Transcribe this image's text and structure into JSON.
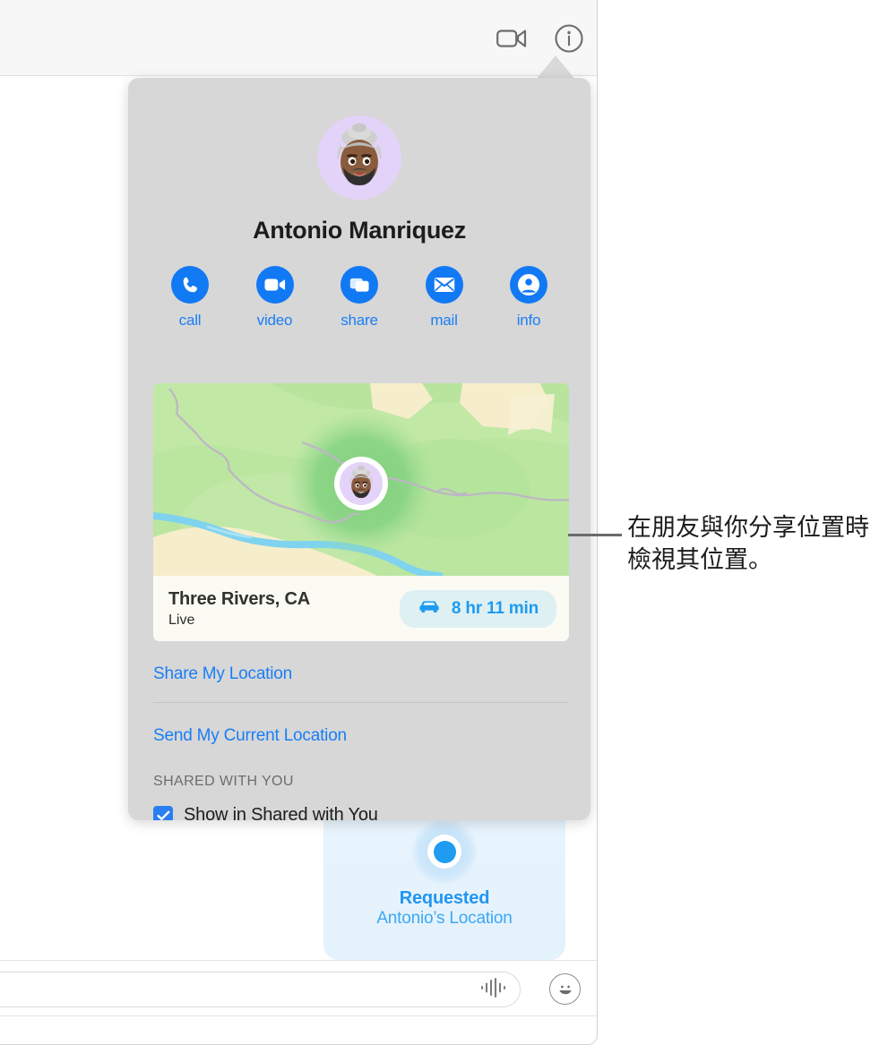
{
  "window": {
    "toolbar": {
      "video_icon": "video-camera-icon",
      "info_icon": "info-circle-icon"
    },
    "compose": {
      "audio_icon": "audio-waveform-icon",
      "emoji_icon": "smiley-face-icon",
      "placeholder": ""
    }
  },
  "bubble": {
    "title": "Requested",
    "subtitle": "Antonio’s Location",
    "dot_icon": "location-dot-icon",
    "accent": "#2196f3"
  },
  "popover": {
    "contact_name": "Antonio Manriquez",
    "avatar_icon": "memoji-avatar",
    "avatar_bg": "#e3d3f8",
    "actions": [
      {
        "label": "call",
        "icon": "phone-icon"
      },
      {
        "label": "video",
        "icon": "video-camera-icon"
      },
      {
        "label": "share",
        "icon": "screen-share-icon"
      },
      {
        "label": "mail",
        "icon": "envelope-icon"
      },
      {
        "label": "info",
        "icon": "person-circle-icon"
      }
    ],
    "action_accent": "#1279f4",
    "map": {
      "place": "Three Rivers, CA",
      "status": "Live",
      "eta": "8 hr 11 min",
      "eta_icon": "car-icon",
      "pin_icon": "memoji-map-pin"
    },
    "links": [
      {
        "label": "Share My Location"
      },
      {
        "label": "Send My Current Location"
      }
    ],
    "section_header": "SHARED WITH YOU",
    "checkbox_row": {
      "label": "Show in Shared with You",
      "checked": true,
      "check_icon": "checkmark-icon"
    }
  },
  "callout": {
    "text": "在朋友與你分享位置時檢視其位置。"
  }
}
